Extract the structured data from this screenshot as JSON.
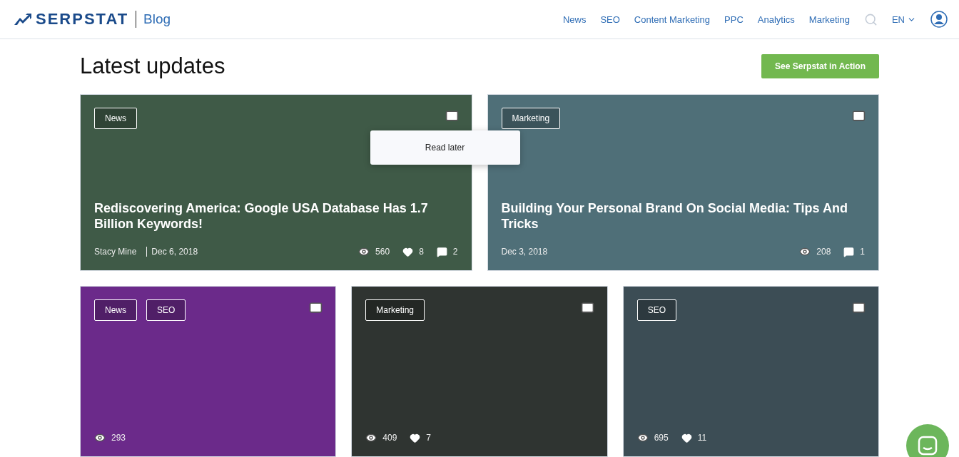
{
  "header": {
    "logo": "SERPSTAT",
    "section": "Blog",
    "nav": [
      "News",
      "SEO",
      "Content Marketing",
      "PPC",
      "Analytics",
      "Marketing"
    ],
    "language": "EN"
  },
  "page_title": "Latest updates",
  "cta_button": "See Serpstat in Action",
  "featured": [
    {
      "tags": [
        "News"
      ],
      "title": "Rediscovering America: Google USA Database Has 1.7 Billion Keywords!",
      "author": "Stacy Mine",
      "date": "Dec 6, 2018",
      "tooltip": "Read later",
      "stats": [
        {
          "kind": "views",
          "value": "560"
        },
        {
          "kind": "likes",
          "value": "8"
        },
        {
          "kind": "comments",
          "value": "2"
        }
      ]
    },
    {
      "tags": [
        "Marketing"
      ],
      "title": "Building Your Personal Brand On Social Media: Tips And Tricks",
      "date": "Dec 3, 2018",
      "stats": [
        {
          "kind": "views",
          "value": "208"
        },
        {
          "kind": "comments",
          "value": "1"
        }
      ]
    }
  ],
  "cards": [
    {
      "tags": [
        "News",
        "SEO"
      ],
      "stats": [
        {
          "kind": "views",
          "value": "293"
        }
      ]
    },
    {
      "tags": [
        "Marketing"
      ],
      "stats": [
        {
          "kind": "views",
          "value": "409"
        },
        {
          "kind": "likes",
          "value": "7"
        }
      ]
    },
    {
      "tags": [
        "SEO"
      ],
      "stats": [
        {
          "kind": "views",
          "value": "695"
        },
        {
          "kind": "likes",
          "value": "11"
        }
      ]
    }
  ]
}
